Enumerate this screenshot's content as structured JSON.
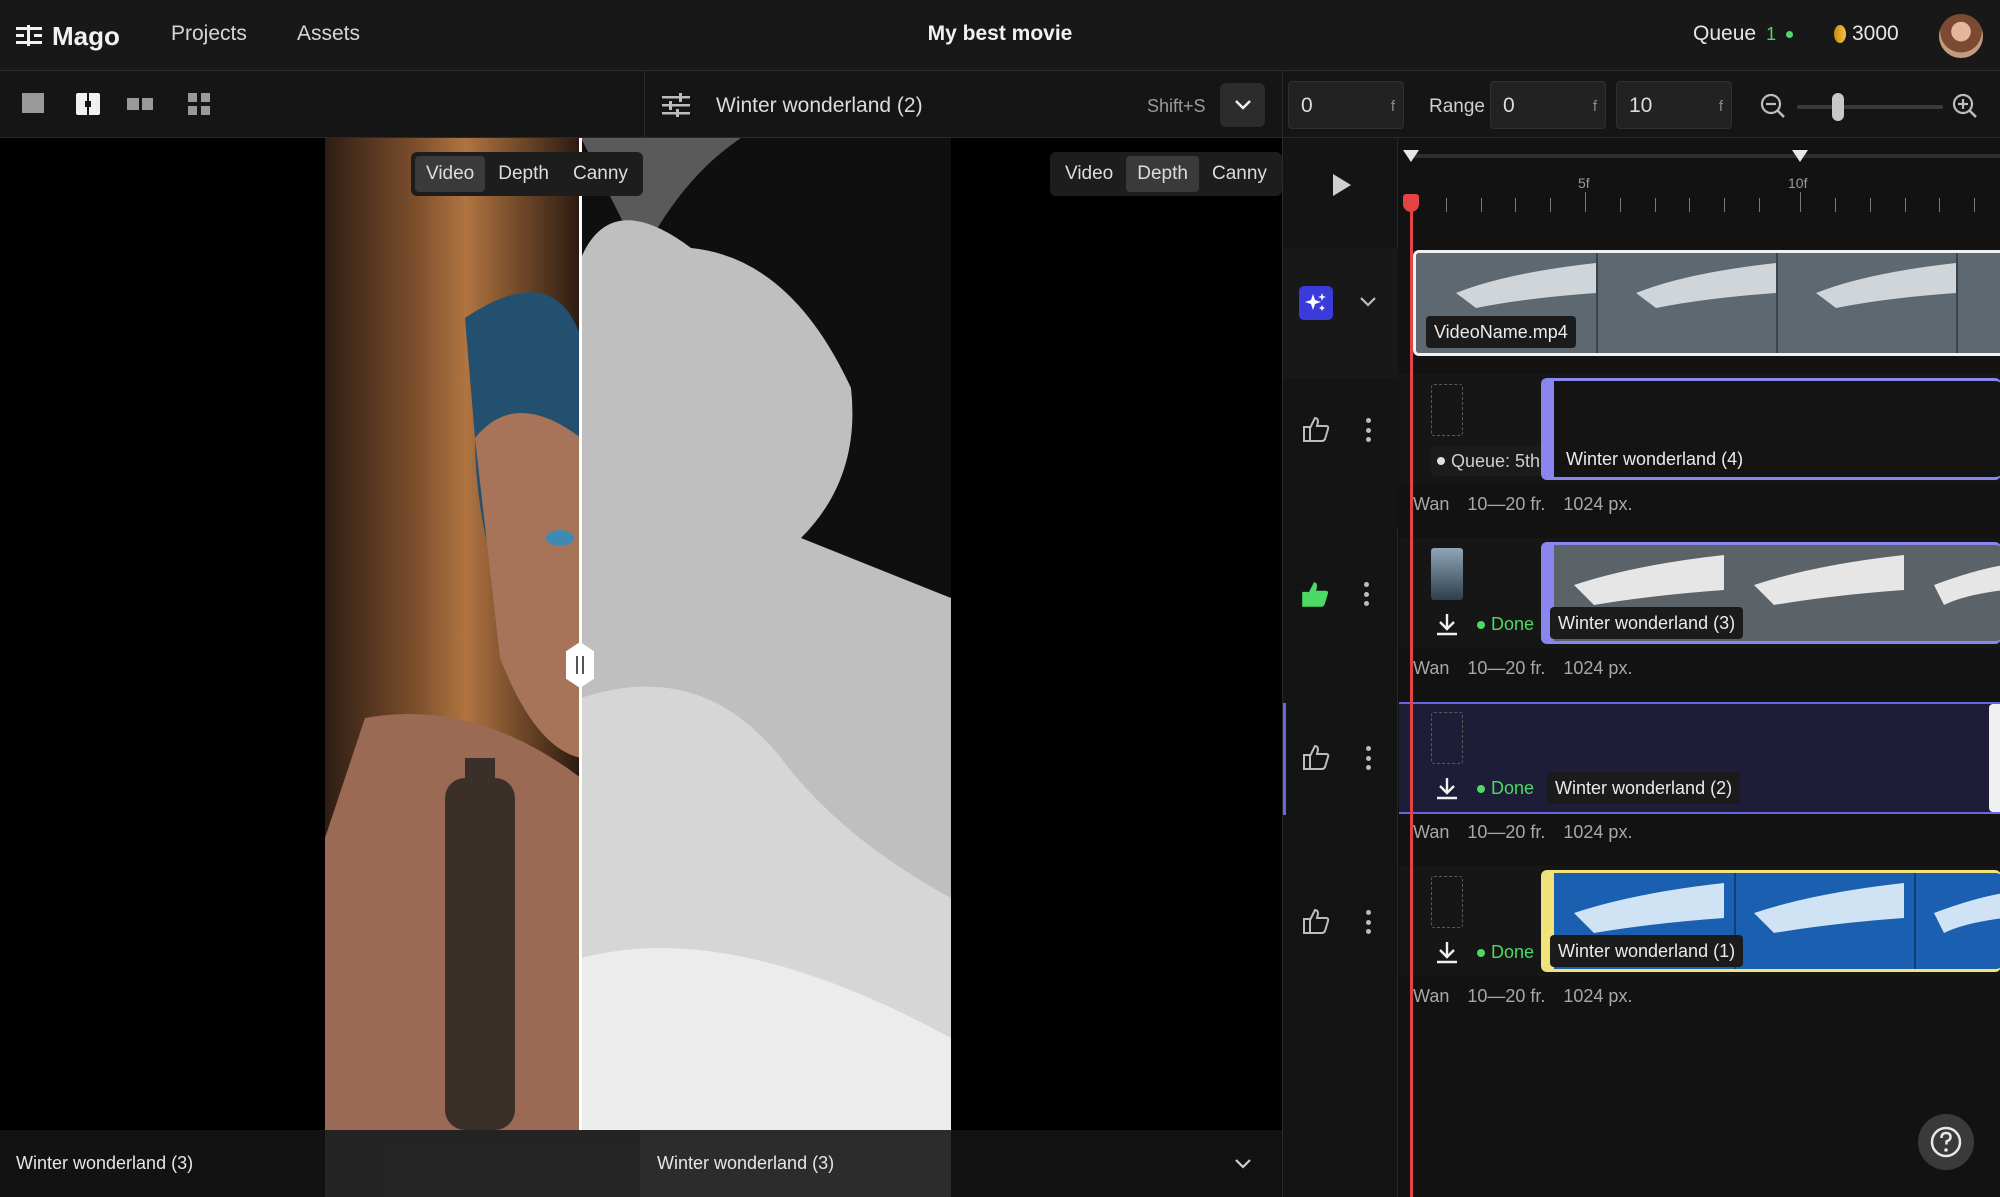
{
  "header": {
    "logo": "Mago",
    "nav": [
      "Projects",
      "Assets"
    ],
    "project_title": "My best movie",
    "queue_label": "Queue",
    "queue_count": "1",
    "credits": "3000"
  },
  "toolbar": {
    "generation_name": "Winter wonderland (2)",
    "shortcut": "Shift+S",
    "current_frame": "0",
    "frame_unit": "f",
    "range_label": "Range",
    "range_start": "0",
    "range_end": "10"
  },
  "viewer": {
    "left_modes": [
      "Video",
      "Depth",
      "Canny"
    ],
    "left_active": "Video",
    "right_modes": [
      "Video",
      "Depth",
      "Canny"
    ],
    "right_active": "Depth",
    "left_caption": "Winter wonderland (3)",
    "right_caption": "Winter wonderland (3)"
  },
  "timeline": {
    "ruler_labels": [
      "5f",
      "10f"
    ],
    "source_clip": "VideoName.mp4",
    "generations": [
      {
        "name": "Winter wonderland (4)",
        "status": "Queue: 5th",
        "model": "Wan",
        "frames": "10—20 fr.",
        "size": "1024 px.",
        "liked": false
      },
      {
        "name": "Winter wonderland (3)",
        "status": "Done",
        "model": "Wan",
        "frames": "10—20 fr.",
        "size": "1024 px.",
        "liked": true
      },
      {
        "name": "Winter wonderland (2)",
        "status": "Done",
        "model": "Wan",
        "frames": "10—20 fr.",
        "size": "1024 px.",
        "liked": false
      },
      {
        "name": "Winter wonderland (1)",
        "status": "Done",
        "model": "Wan",
        "frames": "10—20 fr.",
        "size": "1024 px.",
        "liked": false
      }
    ]
  },
  "colors": {
    "accent_purple": "#8a86f0",
    "accent_yellow": "#f2e27a",
    "done_green": "#4cd964",
    "playhead_red": "#e54343",
    "ai_badge": "#3b3bdb"
  }
}
